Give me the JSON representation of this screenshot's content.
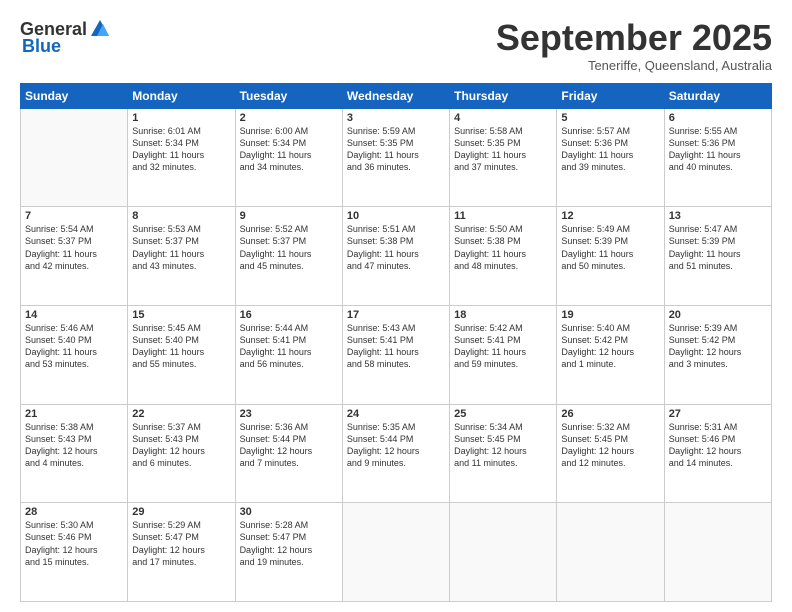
{
  "header": {
    "logo_general": "General",
    "logo_blue": "Blue",
    "month": "September 2025",
    "location": "Teneriffe, Queensland, Australia"
  },
  "days_of_week": [
    "Sunday",
    "Monday",
    "Tuesday",
    "Wednesday",
    "Thursday",
    "Friday",
    "Saturday"
  ],
  "weeks": [
    [
      {
        "day": "",
        "info": ""
      },
      {
        "day": "1",
        "info": "Sunrise: 6:01 AM\nSunset: 5:34 PM\nDaylight: 11 hours\nand 32 minutes."
      },
      {
        "day": "2",
        "info": "Sunrise: 6:00 AM\nSunset: 5:34 PM\nDaylight: 11 hours\nand 34 minutes."
      },
      {
        "day": "3",
        "info": "Sunrise: 5:59 AM\nSunset: 5:35 PM\nDaylight: 11 hours\nand 36 minutes."
      },
      {
        "day": "4",
        "info": "Sunrise: 5:58 AM\nSunset: 5:35 PM\nDaylight: 11 hours\nand 37 minutes."
      },
      {
        "day": "5",
        "info": "Sunrise: 5:57 AM\nSunset: 5:36 PM\nDaylight: 11 hours\nand 39 minutes."
      },
      {
        "day": "6",
        "info": "Sunrise: 5:55 AM\nSunset: 5:36 PM\nDaylight: 11 hours\nand 40 minutes."
      }
    ],
    [
      {
        "day": "7",
        "info": "Sunrise: 5:54 AM\nSunset: 5:37 PM\nDaylight: 11 hours\nand 42 minutes."
      },
      {
        "day": "8",
        "info": "Sunrise: 5:53 AM\nSunset: 5:37 PM\nDaylight: 11 hours\nand 43 minutes."
      },
      {
        "day": "9",
        "info": "Sunrise: 5:52 AM\nSunset: 5:37 PM\nDaylight: 11 hours\nand 45 minutes."
      },
      {
        "day": "10",
        "info": "Sunrise: 5:51 AM\nSunset: 5:38 PM\nDaylight: 11 hours\nand 47 minutes."
      },
      {
        "day": "11",
        "info": "Sunrise: 5:50 AM\nSunset: 5:38 PM\nDaylight: 11 hours\nand 48 minutes."
      },
      {
        "day": "12",
        "info": "Sunrise: 5:49 AM\nSunset: 5:39 PM\nDaylight: 11 hours\nand 50 minutes."
      },
      {
        "day": "13",
        "info": "Sunrise: 5:47 AM\nSunset: 5:39 PM\nDaylight: 11 hours\nand 51 minutes."
      }
    ],
    [
      {
        "day": "14",
        "info": "Sunrise: 5:46 AM\nSunset: 5:40 PM\nDaylight: 11 hours\nand 53 minutes."
      },
      {
        "day": "15",
        "info": "Sunrise: 5:45 AM\nSunset: 5:40 PM\nDaylight: 11 hours\nand 55 minutes."
      },
      {
        "day": "16",
        "info": "Sunrise: 5:44 AM\nSunset: 5:41 PM\nDaylight: 11 hours\nand 56 minutes."
      },
      {
        "day": "17",
        "info": "Sunrise: 5:43 AM\nSunset: 5:41 PM\nDaylight: 11 hours\nand 58 minutes."
      },
      {
        "day": "18",
        "info": "Sunrise: 5:42 AM\nSunset: 5:41 PM\nDaylight: 11 hours\nand 59 minutes."
      },
      {
        "day": "19",
        "info": "Sunrise: 5:40 AM\nSunset: 5:42 PM\nDaylight: 12 hours\nand 1 minute."
      },
      {
        "day": "20",
        "info": "Sunrise: 5:39 AM\nSunset: 5:42 PM\nDaylight: 12 hours\nand 3 minutes."
      }
    ],
    [
      {
        "day": "21",
        "info": "Sunrise: 5:38 AM\nSunset: 5:43 PM\nDaylight: 12 hours\nand 4 minutes."
      },
      {
        "day": "22",
        "info": "Sunrise: 5:37 AM\nSunset: 5:43 PM\nDaylight: 12 hours\nand 6 minutes."
      },
      {
        "day": "23",
        "info": "Sunrise: 5:36 AM\nSunset: 5:44 PM\nDaylight: 12 hours\nand 7 minutes."
      },
      {
        "day": "24",
        "info": "Sunrise: 5:35 AM\nSunset: 5:44 PM\nDaylight: 12 hours\nand 9 minutes."
      },
      {
        "day": "25",
        "info": "Sunrise: 5:34 AM\nSunset: 5:45 PM\nDaylight: 12 hours\nand 11 minutes."
      },
      {
        "day": "26",
        "info": "Sunrise: 5:32 AM\nSunset: 5:45 PM\nDaylight: 12 hours\nand 12 minutes."
      },
      {
        "day": "27",
        "info": "Sunrise: 5:31 AM\nSunset: 5:46 PM\nDaylight: 12 hours\nand 14 minutes."
      }
    ],
    [
      {
        "day": "28",
        "info": "Sunrise: 5:30 AM\nSunset: 5:46 PM\nDaylight: 12 hours\nand 15 minutes."
      },
      {
        "day": "29",
        "info": "Sunrise: 5:29 AM\nSunset: 5:47 PM\nDaylight: 12 hours\nand 17 minutes."
      },
      {
        "day": "30",
        "info": "Sunrise: 5:28 AM\nSunset: 5:47 PM\nDaylight: 12 hours\nand 19 minutes."
      },
      {
        "day": "",
        "info": ""
      },
      {
        "day": "",
        "info": ""
      },
      {
        "day": "",
        "info": ""
      },
      {
        "day": "",
        "info": ""
      }
    ]
  ]
}
